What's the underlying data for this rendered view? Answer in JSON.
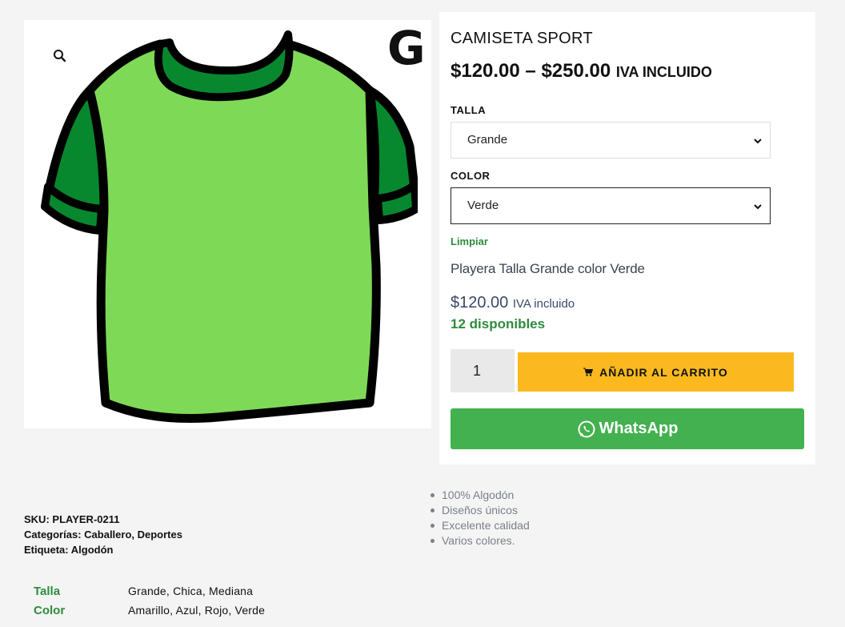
{
  "product": {
    "title": "CAMISETA SPORT",
    "price_range": "$120.00 – $250.00",
    "price_suffix": "IVA INCLUIDO",
    "size_badge": "G"
  },
  "variations": {
    "size_label": "TALLA",
    "size_value": "Grande",
    "color_label": "COLOR",
    "color_value": "Verde",
    "clear_label": "Limpiar"
  },
  "selected_variation": {
    "description": "Playera Talla Grande color Verde",
    "price": "$120.00",
    "price_suffix": "IVA incluido",
    "stock": "12 disponibles"
  },
  "cart": {
    "quantity": "1",
    "add_label": "AÑADIR AL CARRITO",
    "whatsapp_label": "WhatsApp"
  },
  "features": [
    "100% Algodón",
    "Diseños únicos",
    "Excelente calidad",
    "Varios colores."
  ],
  "meta": {
    "sku_label": "SKU:",
    "sku_value": "PLAYER-0211",
    "categories_label": "Categorías:",
    "categories_value": "Caballero, Deportes",
    "tag_label": "Etiqueta:",
    "tag_value": "Algodón"
  },
  "attributes": [
    {
      "name": "Talla",
      "value": "Grande, Chica, Mediana"
    },
    {
      "name": "Color",
      "value": "Amarillo, Azul, Rojo, Verde"
    }
  ],
  "colors": {
    "accent_green": "#2e8b3c",
    "cart_button": "#fbb91f",
    "whatsapp_button": "#43b14f",
    "shirt_body": "#7ed957",
    "shirt_sleeve": "#07882f"
  }
}
